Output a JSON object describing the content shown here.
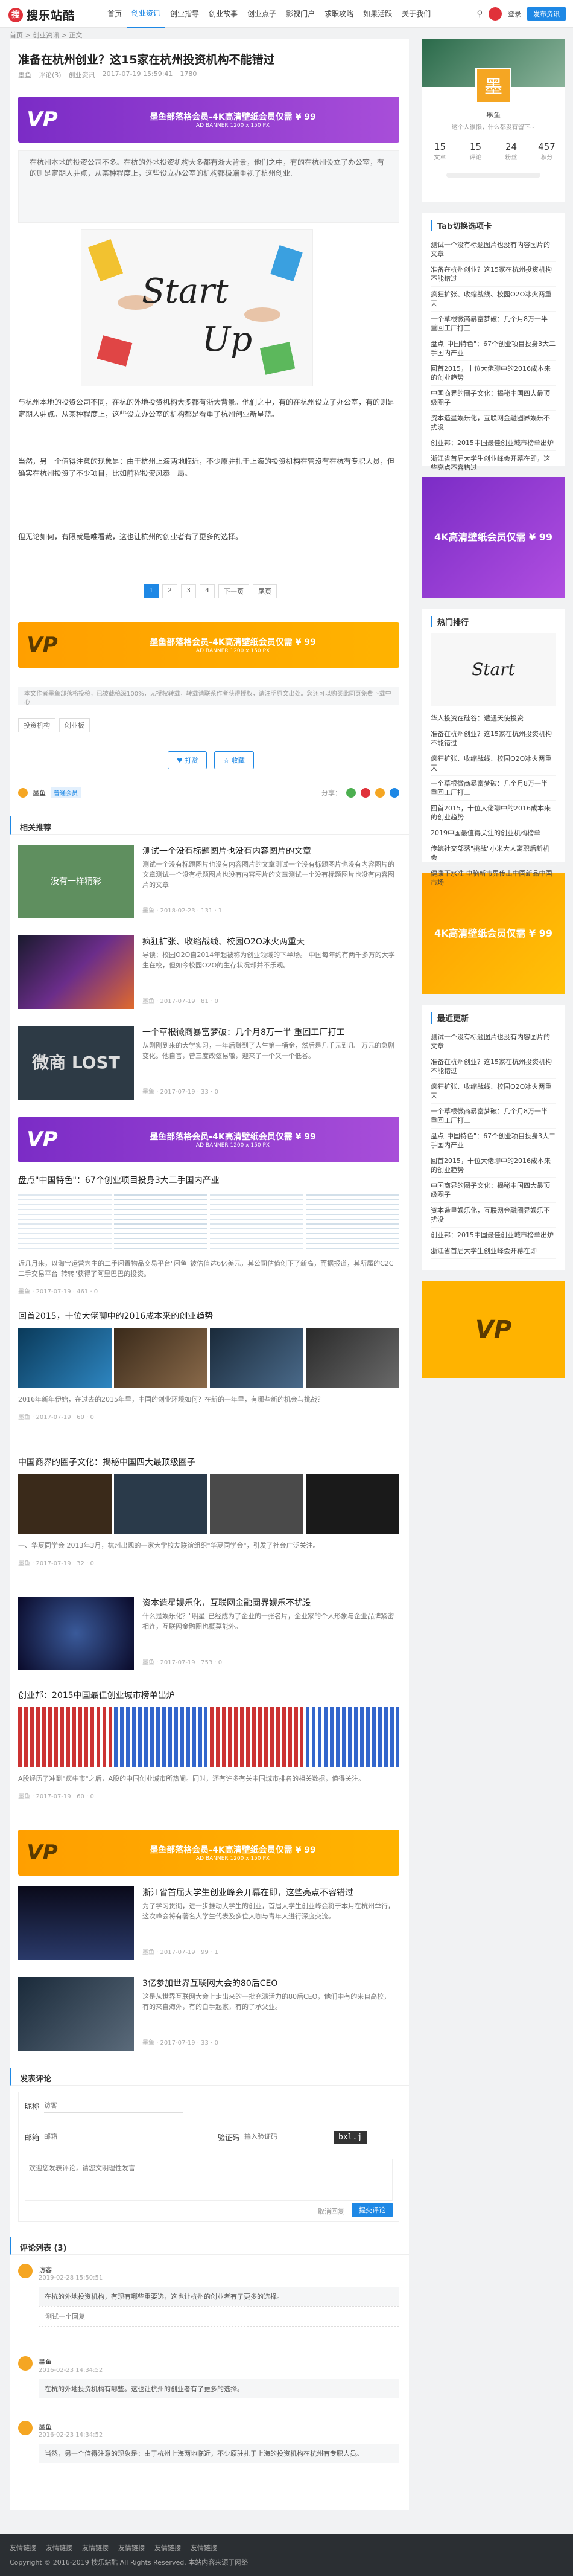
{
  "header": {
    "site_name": "搜乐站酷",
    "nav": [
      "首页",
      "创业资讯",
      "创业指导",
      "创业故事",
      "创业点子",
      "影视门户",
      "求职攻略",
      "如果活跃",
      "关于我们"
    ],
    "login_label": "登录",
    "post_label": "发布资讯"
  },
  "breadcrumb": "首页 > 创业资讯 > 正文",
  "article": {
    "title": "准备在杭州创业？这15家在杭州投资机构不能错过",
    "author": "墨鱼",
    "comments": "评论(3)",
    "category": "创业资讯",
    "date": "2017-07-19 15:59:41",
    "views": "1780",
    "ad_banner": "墨鱼部落格会员-4K高清壁纸会员仅需 ¥ 99",
    "ad_banner_sub": "AD BANNER 1200 x 150 PX",
    "summary": "在杭州本地的投资公司不多。在杭的外地投资机构大多都有浙大背景，他们之中，有的在杭州设立了办公室，有的则是定期人驻点，从某种程度上，这些设立办公室的机构都极端重视了杭州创业.",
    "image_text_1": "Start",
    "image_text_2": "Up",
    "para1": "与杭州本地的投资公司不同，在杭的外地投资机构大多都有浙大背景。他们之中，有的在杭州设立了办公室，有的则是定期人驻点。从某种程度上，这些设立办公室的机构都是看重了杭州创业新星蓝。",
    "para2": "当然，另一个值得注意的现象是：由于杭州上海两地临近，不少原驻扎于上海的投资机构在管沒有在杭有专职人员，但确实在杭州投资了不少项目，比如前程投资风泰一局。",
    "para3": "但无论如何，有限就是唯看裁，这也让杭州的创业者有了更多的选择。",
    "pages": [
      "1",
      "2",
      "3",
      "4",
      "下一页",
      "尾页"
    ],
    "note": "本文作者墨鱼部落格投稿，已被截稿深100%，无授权转载，转载请联系作者获得授权，请注明原文出处。您还可以购买此同页免费下载中心",
    "tags": [
      "投资机构",
      "创业板"
    ],
    "like_label": "♥ 打赏",
    "collect_label": "☆ 收藏",
    "author_tag": "墨鱼",
    "author_badge": "普通会员",
    "share_label": "分享："
  },
  "related": {
    "title": "相关推荐",
    "cards": [
      {
        "title": "测试一个没有标题图片也没有内容图片的文章",
        "excerpt": "测试一个没有标题图片也没有内容图片的文章测试一个没有标题图片也没有内容图片的文章测试一个没有标题图片也没有内容图片的文章测试一个没有标题图片也没有内容图片的文章",
        "meta": "墨鱼 · 2018-02-23 · 131 · 1",
        "thumb": "没有一样精彩"
      },
      {
        "title": "疯狂扩张、收缩战线、校园O2O冰火两重天",
        "excerpt": "导读：校园O2O自2014年起被称为创业领域的下半场。 中国每年约有两千多万的大学生在校，但如今校园O2O的生存状况却并不乐观。",
        "meta": "墨鱼 · 2017-07-19 · 81 · 0",
        "thumb": ""
      },
      {
        "title": "一个草根微商暴富梦破：几个月8万一半 重回工厂打工",
        "excerpt": "从刚刚到来的大学实习，一年后赚到了人生第一桶金，然后是几千元到几十万元的急剧变化。他自言，曾三度改弦易辙，迎来了一个又一个低谷。",
        "meta": "墨鱼 · 2017-07-19 · 33 · 0",
        "thumb": "微商 LOST"
      }
    ],
    "ad_banner": "墨鱼部落格会员-4K高清壁纸会员仅需 ¥ 99",
    "bar1": {
      "title": "盘点\"中国特色\"：67个创业项目投身3大二手国内产业",
      "excerpt": "近几月来，以淘宝运营为主的二手闲置物品交易平台\"闲鱼\"被估值达6亿美元，其公司估值创下了新高，而据报道，其所属的C2C二手交易平台\"转转\"获得了阿里巴巴的投资。",
      "meta": "墨鱼 · 2017-07-19 · 461 · 0"
    },
    "bar2": {
      "title": "回首2015，十位大佬聊中的2016成本来的创业趋势",
      "excerpt": "2016年新年伊始，在过去的2015年里，中国的创业环境如何？在新的一年里，有哪些新的机会与挑战？",
      "meta": "墨鱼 · 2017-07-19 · 60 · 0"
    },
    "bar3": {
      "title": "中国商界的圈子文化：揭秘中国四大最顶级圈子",
      "excerpt": "一、华夏同学会 2013年3月，杭州出现的一家大学校友联谊组织\"华夏同学会\"，引发了社会广泛关注。",
      "meta": "墨鱼 · 2017-07-19 · 32 · 0"
    },
    "card4": {
      "title": "资本造星娱乐化，互联网金融圈界娱乐不扰没",
      "excerpt": "什么是娱乐化？\"明星\"已经成为了企业的一张名片，企业家的个人形象与企业品牌紧密相连，互联网金融圈也概莫能外。",
      "meta": "墨鱼 · 2017-07-19 · 753 · 0",
      "thumb": ""
    },
    "bar4": {
      "title": "创业邦：2015中国最佳创业城市榜单出炉",
      "excerpt": "A股经历了冲到\"疯牛市\"之后，A股的中国创业城市所热闹。同时，还有许多有关中国城市排名的相关数据，值得关注。",
      "meta": "墨鱼 · 2017-07-19 · 60 · 0"
    },
    "ad_banner2": "墨鱼部落格会员-4K高清壁纸会员仅需 ¥ 99",
    "card5": {
      "title": "浙江省首届大学生创业峰会开幕在即，这些亮点不容错过",
      "excerpt": "为了学习贯彻，进一步推动大学生的创业，首届大学生创业峰会将于本月在杭州举行，这次峰会将有著名大学生代表及多位大咖与青年人进行深度交流。",
      "meta": "墨鱼 · 2017-07-19 · 99 · 1",
      "thumb": ""
    },
    "card6": {
      "title": "3亿参加世界互联网大会的80后CEO",
      "excerpt": "这是从世界互联网大会上走出来的一批充满活力的80后CEO，他们中有的来自高校，有的来自海外，有的白手起家，有的子承父业。",
      "meta": "墨鱼 · 2017-07-19 · 33 · 0",
      "thumb": ""
    }
  },
  "comment_form": {
    "title": "发表评论",
    "nick_label": "昵称",
    "nick_placeholder": "访客",
    "email_label": "邮箱",
    "email_placeholder": "邮箱",
    "url_label": "网址",
    "url_placeholder": "网址",
    "captcha_label": "验证码",
    "captcha_placeholder": "输入验证码",
    "captcha_code": "bxl.j",
    "textarea_placeholder": "欢迎您发表评论，请您文明理性发言",
    "cancel_label": "取消回复",
    "submit_label": "提交评论"
  },
  "comments": {
    "title": "评论列表 (3)",
    "items": [
      {
        "name": "访客",
        "date": "2019-02-28 15:50:51",
        "text": "在杭的外地投资机构，有现有哪些重要选，这也让杭州的创业者有了更多的选择。"
      },
      {
        "name": "墨鱼",
        "date": "2016-02-23 14:34:52",
        "text": "在杭的外地投资机构有哪些。这也让杭州的创业者有了更多的选择。"
      },
      {
        "name": "墨鱼",
        "date": "2016-02-23 14:34:52",
        "text": "当然，另一个值得注意的现象是：由于杭州上海两地临近，不少原驻扎于上海的投资机构在杭州有专职人员。"
      }
    ],
    "reply_label": "回复",
    "quote_text": "测试一个回复"
  },
  "sidebar": {
    "profile": {
      "name": "墨鱼",
      "bio": "这个人很懒，什么都没有留下~",
      "stats": [
        {
          "n": "15",
          "l": "文章"
        },
        {
          "n": "15",
          "l": "评论"
        },
        {
          "n": "24",
          "l": "粉丝"
        },
        {
          "n": "457",
          "l": "积分"
        }
      ],
      "logo_char": "墨"
    },
    "tags_title": "Tab切换选项卡",
    "tags_items": [
      "测试一个没有标题图片也没有内容图片的文章",
      "准备在杭州创业？这15家在杭州投资机构不能错过",
      "疯狂扩张、收缩战线、校园O2O冰火两重天",
      "一个草根微商暴富梦破：几个月8万一半 重回工厂打工",
      "盘点\"中国特色\"：67个创业项目投身3大二手国内产业",
      "回首2015，十位大佬聊中的2016成本来的创业趋势",
      "中国商界的圈子文化：揭秘中国四大最顶级圈子",
      "资本造星娱乐化，互联网金融圈界娱乐不扰没",
      "创业邦：2015中国最佳创业城市榜单出炉",
      "浙江省首届大学生创业峰会开幕在即，这些亮点不容错过"
    ],
    "ad1": "4K高清壁纸会员仅需 ¥ 99",
    "hot_title": "热门排行",
    "hot_items": [
      "华人投资在硅谷：遭遇天使投资",
      "准备在杭州创业？这15家在杭州投资机构不能错过",
      "疯狂扩张、收缩战线、校园O2O冰火两重天",
      "一个草根微商暴富梦破：几个月8万一半 重回工厂打工",
      "回首2015，十位大佬聊中的2016成本来的创业趋势",
      "2019中国最值得关注的创业机构榜单",
      "传统社交部落\"挑战\"小米大人离职后新机会",
      "健康下水准 电脑新市界传出中国新品中国市场"
    ],
    "ad2": "4K高清壁纸会员仅需 ¥ 99",
    "new_title": "最近更新",
    "new_items": [
      "测试一个没有标题图片也没有内容图片的文章",
      "准备在杭州创业？这15家在杭州投资机构不能错过",
      "疯狂扩张、收缩战线、校园O2O冰火两重天",
      "一个草根微商暴富梦破：几个月8万一半 重回工厂打工",
      "盘点\"中国特色\"：67个创业项目投身3大二手国内产业",
      "回首2015，十位大佬聊中的2016成本来的创业趋势",
      "中国商界的圈子文化：揭秘中国四大最顶级圈子",
      "资本造星娱乐化，互联网金融圈界娱乐不扰没",
      "创业邦：2015中国最佳创业城市榜单出炉",
      "浙江省首届大学生创业峰会开幕在即"
    ]
  },
  "footer": {
    "links": [
      "友情链接",
      "友情链接",
      "友情链接",
      "友情链接",
      "友情链接",
      "友情链接"
    ],
    "copyright": "Copyright © 2016-2019 搜乐站酷 All Rights Reserved. 本站内容来源于网络"
  },
  "colors": {
    "accent": "#1e88e5",
    "brand": "#e0313a",
    "ad_purple": "#8e3ecf",
    "ad_orange": "#ffa500"
  }
}
